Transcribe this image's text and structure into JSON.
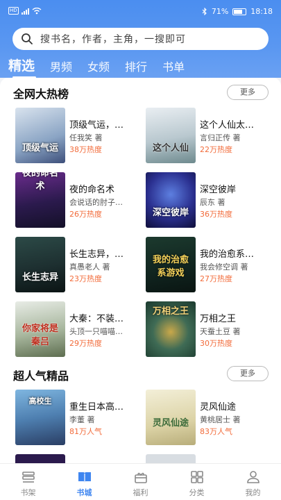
{
  "status_bar": {
    "network": "HD",
    "battery": "71%",
    "time": "18:18",
    "icons": [
      "wifi-icon",
      "bluetooth-icon",
      "signal-icon",
      "battery-icon"
    ]
  },
  "search": {
    "placeholder": "搜书名，作者，主角，一搜即可",
    "icon": "search-icon"
  },
  "tabs": [
    {
      "label": "精选",
      "active": true
    },
    {
      "label": "男频"
    },
    {
      "label": "女频"
    },
    {
      "label": "排行"
    },
    {
      "label": "书单"
    }
  ],
  "sections": [
    {
      "title": "全网大热榜",
      "more_label": "更多",
      "books": [
        {
          "title": "顶级气运，…",
          "author": "任我笑 著",
          "heat": "38万热度",
          "cover_text": "顶级气运"
        },
        {
          "title": "这个人仙太…",
          "author": "言归正传 著",
          "heat": "22万热度",
          "cover_text": "这个人仙"
        },
        {
          "title": "夜的命名术",
          "author": "会说话的肘子…",
          "heat": "26万热度",
          "cover_text": "夜的命名术"
        },
        {
          "title": "深空彼岸",
          "author": "辰东 著",
          "heat": "36万热度",
          "cover_text": "深空彼岸"
        },
        {
          "title": "长生志异，…",
          "author": "真愚老人 著",
          "heat": "23万热度",
          "cover_text": "长生志异"
        },
        {
          "title": "我的治愈系…",
          "author": "我会修空调 著",
          "heat": "27万热度",
          "cover_text": "我的治愈系游戏"
        },
        {
          "title": "大秦：不装…",
          "author": "头顶一只喵喵…",
          "heat": "29万热度",
          "cover_text": "你家将是秦吕"
        },
        {
          "title": "万相之王",
          "author": "天蚕土豆 著",
          "heat": "30万热度",
          "cover_text": "万相之王"
        }
      ]
    },
    {
      "title": "超人气精品",
      "more_label": "更多",
      "books": [
        {
          "title": "重生日本高…",
          "author": "李董 著",
          "heat": "81万人气",
          "cover_text": "高校生"
        },
        {
          "title": "灵风仙途",
          "author": "黄桃居士 著",
          "heat": "83万人气",
          "cover_text": "灵风仙途"
        }
      ]
    }
  ],
  "bottom_nav": [
    {
      "label": "书架",
      "icon": "bookshelf-icon"
    },
    {
      "label": "书城",
      "icon": "bookstore-icon",
      "active": true
    },
    {
      "label": "福利",
      "icon": "gift-icon"
    },
    {
      "label": "分类",
      "icon": "category-icon"
    },
    {
      "label": "我的",
      "icon": "profile-icon"
    }
  ],
  "colors": {
    "accent": "#3f86f0",
    "heat": "#f26b3a",
    "header": "#4b8ef0"
  }
}
